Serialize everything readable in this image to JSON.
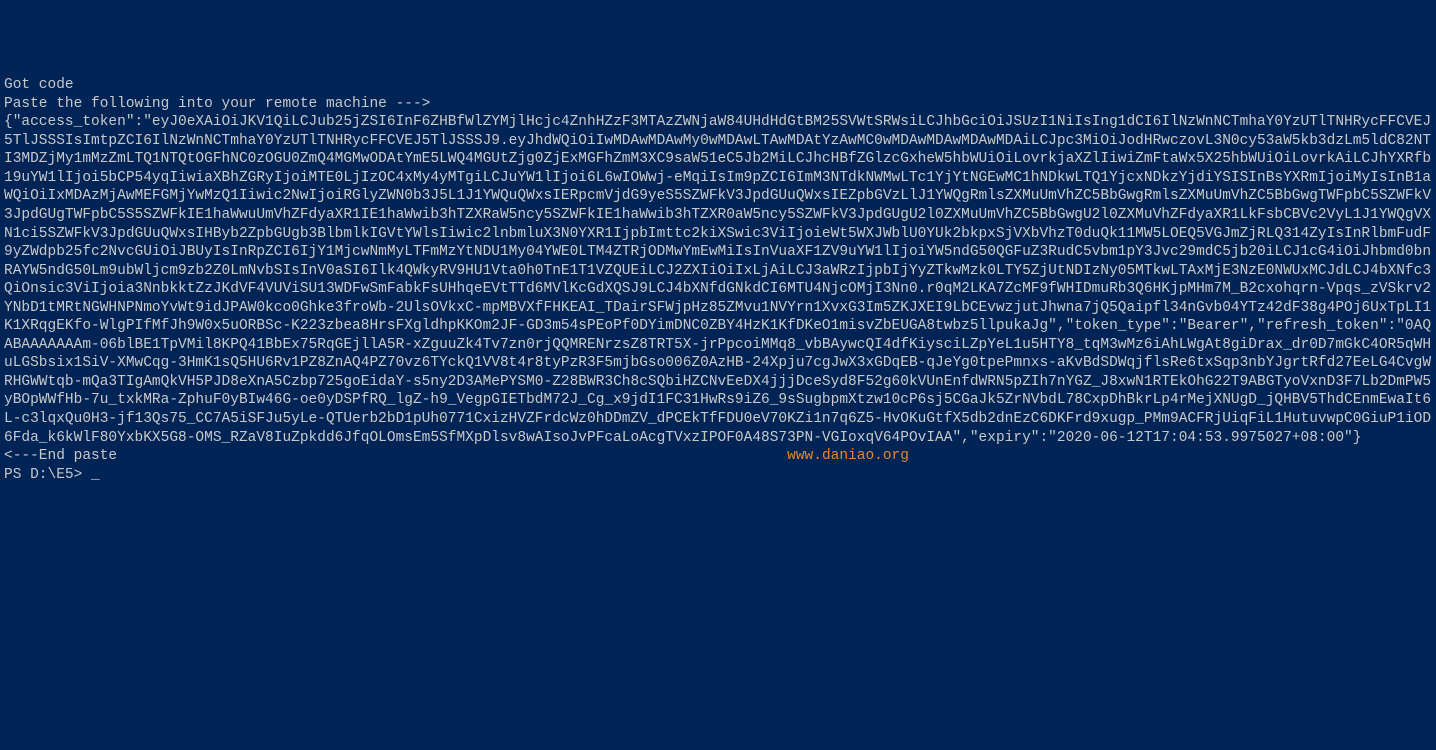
{
  "terminal": {
    "line1": "Got code",
    "line2": "Paste the following into your remote machine --->",
    "token_json": "{\"access_token\":\"eyJ0eXAiOiJKV1QiLCJub25jZSI6InF6ZHBfWlZYMjlHcjc4ZnhHZzF3MTAzZWNjaW84UHdHdGtBM25SVWtSRWsiLCJhbGciOiJSUzI1NiIsIng1dCI6IlNzWnNCTmhaY0YzUTlTNHRycFFCVEJ5TlJSSSIsImtpZCI6IlNzWnNCTmhaY0YzUTlTNHRycFFCVEJ5TlJSSSJ9.eyJhdWQiOiIwMDAwMDAwMy0wMDAwLTAwMDAtYzAwMC0wMDAwMDAwMDAwMDAiLCJpc3MiOiJodHRwczovL3N0cy53aW5kb3dzLm5ldC82NTI3MDZjMy1mMzZmLTQ1NTQtOGFhNC0zOGU0ZmQ4MGMwODAtYmE5LWQ4MGUtZjg0ZjExMGFhZmM3XC9saW51eC5Jb2MiLCJhcHBfZGlzcGxheW5hbWUiOiLovrkjaXZlIiwiZmFtaWx5X25hbWUiOiLovrkAiLCJhYXRfb19uYW1lIjoi5bCP54yqIiwiaXBhZGRyIjoiMTE0LjIzOC4xMy4yMTgiLCJuYW1lIjoi6L6wIOWwj-eMqiIsIm9pZCI6ImM3NTdkNWMwLTc1YjYtNGEwMC1hNDkwLTQ1YjcxNDkzYjdiYSISInBsYXRmIjoiMyIsInB1aWQiOiIxMDAzMjAwMEFGMjYwMzQ1Iiwic2NwIjoiRGlyZWN0b3J5L1J1YWQuQWxsIERpcmVjdG9yeS5SZWFkV3JpdGUuQWxsIEZpbGVzLlJ1YWQgRmlsZXMuUmVhZC5BbGwgRmlsZXMuUmVhZC5BbGwgTWFpbC5SZWFkV3JpdGUgTWFpbC5S5SZWFkIE1haWwuUmVhZFdyaXR1IE1haWwib3hTZXRaW5ncy5SZWFkIE1haWwib3hTZXR0aW5ncy5SZWFkV3JpdGUgU2l0ZXMuUmVhZC5BbGwgU2l0ZXMuVhZFdyaXR1LkFsbCBVc2VyL1J1YWQgVXN1ci5SZWFkV3JpdGUuQWxsIHByb2ZpbGUgb3BlbmlkIGVtYWlsIiwic2lnbmluX3N0YXR1IjpbImttc2kiXSwic3ViIjoieWt5WXJWblU0YUk2bkpxSjVXbVhzT0duQk11MW5LOEQ5VGJmZjRLQ314ZyIsInRlbmFudF9yZWdpb25fc2NvcGUiOiJBUyIsInRpZCI6IjY1MjcwNmMyLTFmMzYtNDU1My04YWE0LTM4ZTRjODMwYmEwMiIsInVuaXF1ZV9uYW1lIjoiYW5ndG50QGFuZ3RudC5vbm1pY3Jvc29mdC5jb20iLCJ1cG4iOiJhbmd0bnRAYW5ndG50Lm9ubWljcm9zb2Z0LmNvbSIsInV0aSI6Ilk4QWkyRV9HU1Vta0h0TnE1T1VZQUEiLCJ2ZXIiOiIxLjAiLCJ3aWRzIjpbIjYyZTkwMzk0LTY5ZjUtNDIzNy05MTkwLTAxMjE3NzE0NWUxMCJdLCJ4bXNfc3QiOnsic3ViIjoia3NnbkktZzJKdVF4VUViSU13WDFwSmFabkFsUHhqeEVtTTd6MVlKcGdXQSJ9LCJ4bXNfdGNkdCI6MTU4NjcOMjI3Nn0.r0qM2LKA7ZcMF9fWHIDmuRb3Q6HKjpMHm7M_B2cxohqrn-Vpqs_zVSkrv2YNbD1tMRtNGWHNPNmoYvWt9idJPAW0kco0Ghke3froWb-2UlsOVkxC-mpMBVXfFHKEAI_TDairSFWjpHz85ZMvu1NVYrn1XvxG3Im5ZKJXEI9LbCEvwzjutJhwna7jQ5Qaipfl34nGvb04YTz42dF38g4POj6UxTpLI1K1XRqgEKfo-WlgPIfMfJh9W0x5uORBSc-K223zbea8HrsFXgldhpKKOm2JF-GD3m54sPEoPf0DYimDNC0ZBY4HzK1KfDKeO1misvZbEUGA8twbz5llpukaJg\",\"token_type\":\"Bearer\",\"refresh_token\":\"0AQABAAAAAAAm-06blBE1TpVMil8KPQ41BbEx75RqGEjllA5R-xZguuZk4Tv7zn0rjQQMRENrzsZ8TRT5X-jrPpcoiMMq8_vbBAywcQI4dfKiysciLZpYeL1u5HTY8_tqM3wMz6iAhLWgAt8giDrax_dr0D7mGkC4OR5qWHuLGSbsix1SiV-XMwCqg-3HmK1sQ5HU6Rv1PZ8ZnAQ4PZ70vz6TYckQ1VV8t4r8tyPzR3F5mjbGso006Z0AzHB-24Xpju7cgJwX3xGDqEB-qJeYg0tpePmnxs-aKvBdSDWqjflsRe6txSqp3nbYJgrtRfd27EeLG4CvgWRHGWWtqb-mQa3TIgAmQkVH5PJD8eXnA5Czbp725goEidaY-s5ny2D3AMePYSM0-Z28BWR3Ch8cSQbiHZCNvEeDX4jjjDceSyd8F52g60kVUnEnfdWRN5pZIh7nYGZ_J8xwN1RTEkOhG22T9ABGTyoVxnD3F7Lb2DmPW5yBOpWWfHb-7u_txkMRa-ZphuF0yBIw46G-oe0yDSPfRQ_lgZ-h9_VegpGIETbdM72J_Cg_x9jdI1FC31HwRs9iZ6_9sSugbpmXtzw10cP6sj5CGaJk5ZrNVbdL78CxpDhBkrLp4rMejXNUgD_jQHBV5ThdCEnmEwaIt6L-c3lqxQu0H3-jf13Qs75_CC7A5iSFJu5yLe-QTUerb2bD1pUh0771CxizHVZFrdcWz0hDDmZV_dPCEkTfFDU0eV70KZi1n7q6Z5-HvOKuGtfX5db2dnEzC6DKFrd9xugp_PMm9ACFRjUiqFiL1HutuvwpC0GiuP1iOD6Fda_k6kWlF80YxbKX5G8-OMS_RZaV8IuZpkdd6JfqOLOmsEm5SfMXpDlsv8wAIsoJvPFcaLoAcgTVxzIPOF0A48S73PN-VGIoxqV64POvIAA\",\"expiry\":\"2020-06-12T17:04:53.9975027+08:00\"}",
    "end_paste": "<---End paste",
    "watermark": "www.daniao.org",
    "prompt": "PS D:\\E5>",
    "cursor": "_"
  }
}
